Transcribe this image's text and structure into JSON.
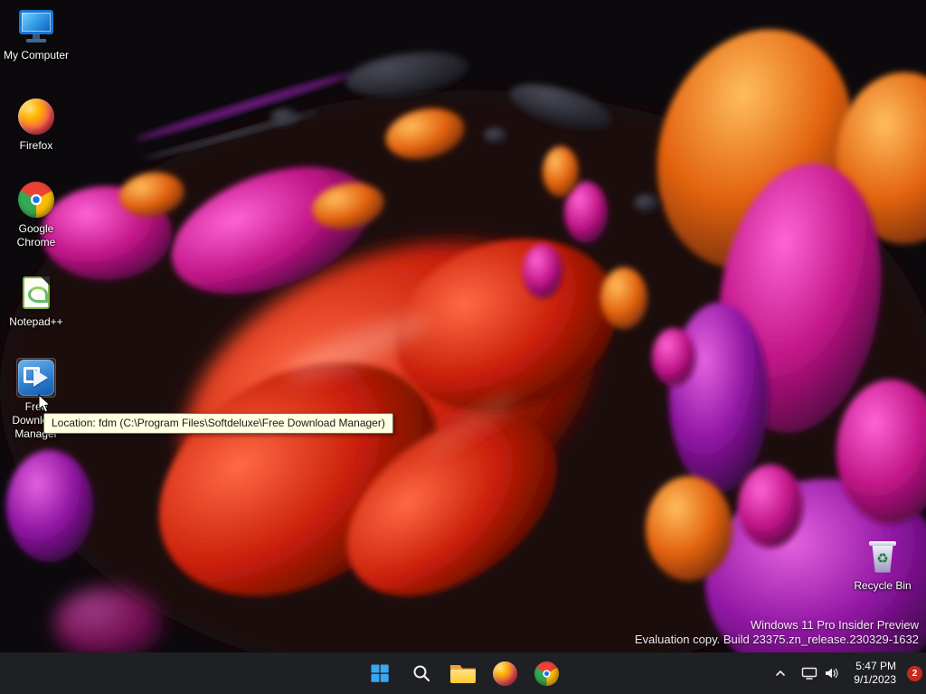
{
  "desktop": {
    "icons": [
      {
        "label": "My Computer"
      },
      {
        "label": "Firefox"
      },
      {
        "label": "Google Chrome"
      },
      {
        "label": "Notepad++"
      },
      {
        "label": "Free Download Manager"
      },
      {
        "label": "Recycle Bin"
      }
    ],
    "tooltip_text": "Location: fdm (C:\\Program Files\\Softdeluxe\\Free Download Manager)",
    "watermark_line1": "Windows 11 Pro Insider Preview",
    "watermark_line2": "Evaluation copy. Build 23375.zn_release.230329-1632"
  },
  "taskbar": {
    "buttons": [
      {
        "icon": "start-icon"
      },
      {
        "icon": "search-icon"
      },
      {
        "icon": "file-explorer-icon"
      },
      {
        "icon": "firefox-icon"
      },
      {
        "icon": "chrome-icon"
      }
    ],
    "tray_icons": [
      "chevron-up-icon",
      "network-display-icon",
      "volume-icon"
    ],
    "tray": {
      "time": "5:47 PM",
      "date": "9/1/2023",
      "notification_count": "2"
    }
  },
  "colors": {
    "taskbar_bg": "#1e2024",
    "accent_blue": "#3aa7f0",
    "badge_red": "#c42b1c",
    "tooltip_bg": "#ffffe1"
  }
}
